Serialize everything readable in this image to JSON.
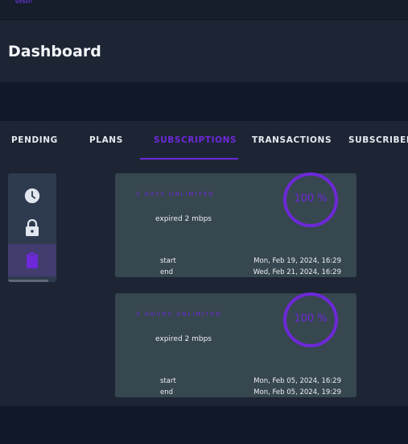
{
  "app": {
    "logo_text": "WEBAPI"
  },
  "header": {
    "title": "Dashboard"
  },
  "tabs": [
    {
      "label": "PENDING"
    },
    {
      "label": "PLANS"
    },
    {
      "label": "SUBSCRIPTIONS"
    },
    {
      "label": "TRANSACTIONS"
    },
    {
      "label": "SUBSCRIBERS"
    }
  ],
  "active_tab": "SUBSCRIPTIONS",
  "sidebar": {
    "items": [
      {
        "icon": "clock-icon",
        "active": false
      },
      {
        "icon": "lock-icon",
        "active": false
      },
      {
        "icon": "clipboard-icon",
        "active": true
      }
    ]
  },
  "subscriptions": [
    {
      "name": "2 DAYS UNLIMITED",
      "description": "expired 2 mbps",
      "progress_percent": 100,
      "progress_label": "100 %",
      "start_label": "start",
      "start": "Mon, Feb 19, 2024, 16:29",
      "end_label": "end",
      "end": "Wed, Feb 21, 2024, 16:29"
    },
    {
      "name": "3 HOURS UNLIMITED",
      "description": "expired 2 mbps",
      "progress_percent": 100,
      "progress_label": "100 %",
      "start_label": "start",
      "start": "Mon, Feb 05, 2024, 16:29",
      "end_label": "end",
      "end": "Mon, Feb 05, 2024, 19:29"
    }
  ],
  "colors": {
    "accent": "#6d28d9",
    "card": "#37474f",
    "panel": "#1d2534",
    "background": "#121826"
  }
}
